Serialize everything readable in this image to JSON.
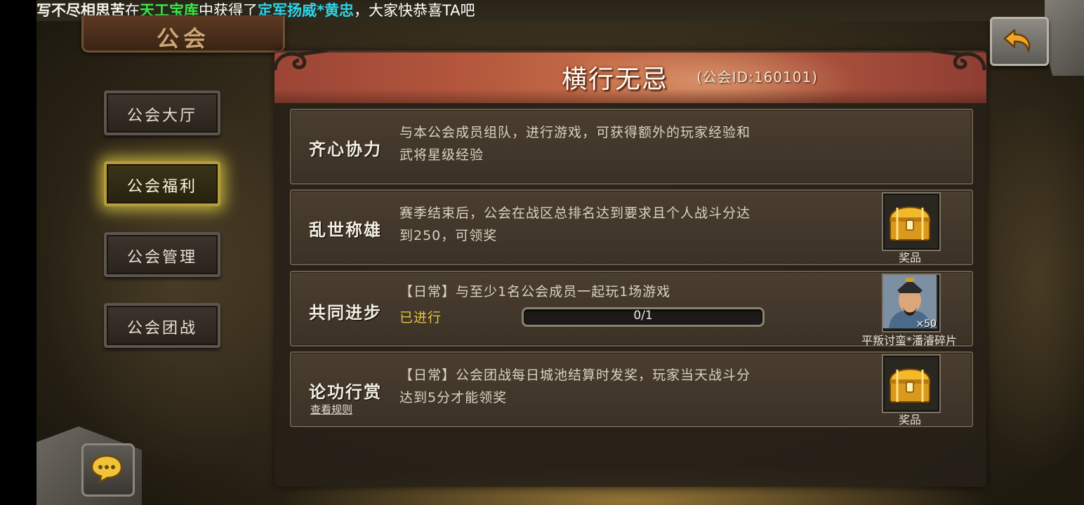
{
  "marquee": {
    "player": "写不尽相思苦",
    "in": "在",
    "place": "天工宝库",
    "got": "中获得了",
    "item": "定军扬威*黄忠",
    "congrats": "，大家快恭喜TA吧"
  },
  "guild_plaque": "公会",
  "header": {
    "guild_name": "横行无忌",
    "guild_id": "(公会ID:160101)"
  },
  "sidebar": {
    "items": [
      {
        "label": "公会大厅",
        "active": false
      },
      {
        "label": "公会福利",
        "active": true
      },
      {
        "label": "公会管理",
        "active": false
      },
      {
        "label": "公会团战",
        "active": false
      }
    ]
  },
  "rows": [
    {
      "title": "齐心协力",
      "desc_line1": "与本公会成员组队，进行游戏，可获得额外的玩家经验和",
      "desc_line2": "武将星级经验"
    },
    {
      "title": "乱世称雄",
      "desc_line1": "赛季结束后，公会在战区总排名达到要求且个人战斗分达",
      "desc_line2": "到250，可领奖",
      "reward": {
        "icon": "treasure-chest-icon",
        "caption": "奖品"
      }
    },
    {
      "title": "共同进步",
      "desc_line1": "【日常】与至少1名公会成员一起玩1场游戏",
      "status": "已进行",
      "progress_text": "0/1",
      "progress_value": 0,
      "reward": {
        "icon": "general-portrait-icon",
        "count": "×50",
        "caption": "平叛讨蛮*潘濬碎片"
      }
    },
    {
      "title": "论功行赏",
      "rule_link": "查看规则",
      "desc_line1": "【日常】公会团战每日城池结算时发奖，玩家当天战斗分",
      "desc_line2": "达到5分才能领奖",
      "reward": {
        "icon": "treasure-chest-icon",
        "caption": "奖品"
      }
    }
  ],
  "icons": {
    "back": "back-arrow-icon",
    "chat": "chat-bubble-icon"
  },
  "colors": {
    "marquee_place": "#38e84a",
    "marquee_item": "#2ed4ea",
    "active_glow": "#ebd746",
    "status_text": "#e4c24a"
  }
}
